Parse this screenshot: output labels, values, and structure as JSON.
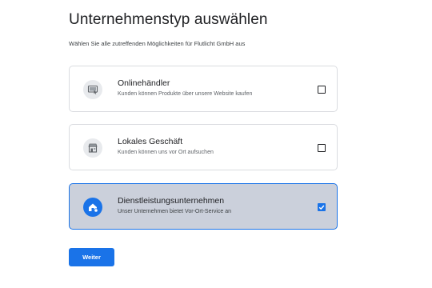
{
  "heading": {
    "title": "Unternehmenstyp auswählen",
    "subtitle": "Wählen Sie alle zutreffenden Möglichkeiten für Flutlicht GmbH aus"
  },
  "options": [
    {
      "title": "Onlinehändler",
      "description": "Kunden können Produkte über unsere Website kaufen",
      "icon": "online-store-icon",
      "checked": false
    },
    {
      "title": "Lokales Geschäft",
      "description": "Kunden können uns vor Ort aufsuchen",
      "icon": "storefront-icon",
      "checked": false
    },
    {
      "title": "Dienstleistungsunternehmen",
      "description": "Unser Unternehmen bietet Vor-Ort-Service an",
      "icon": "service-home-icon",
      "checked": true
    }
  ],
  "actions": {
    "next_label": "Weiter"
  },
  "colors": {
    "accent": "#1a73e8",
    "selected_bg": "#cbd0db",
    "border": "#dadce0",
    "icon_bg": "#e8eaed"
  }
}
